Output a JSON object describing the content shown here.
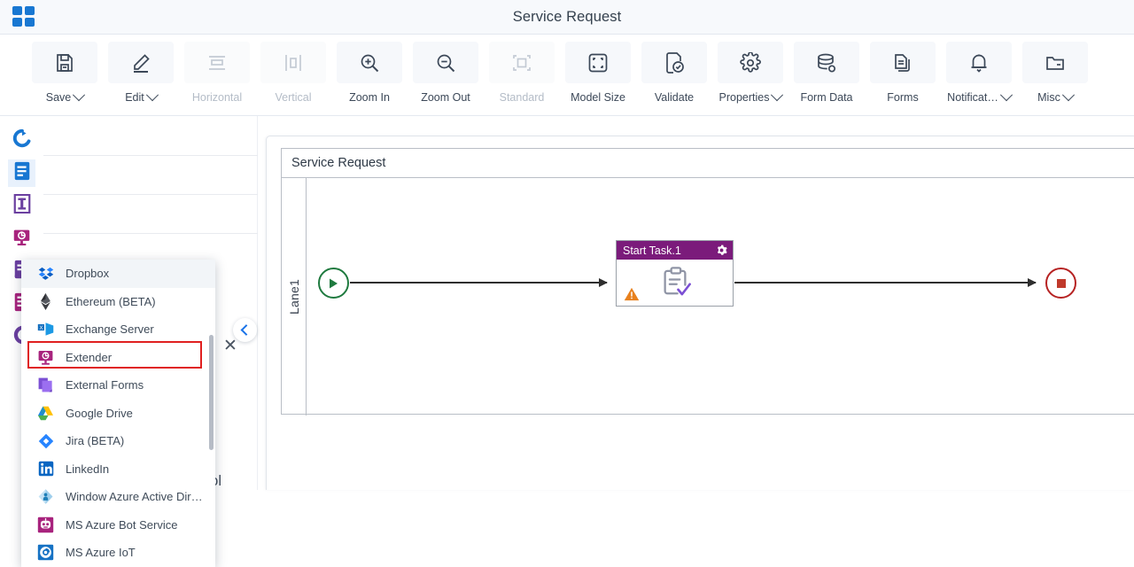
{
  "app": {
    "logo_icon": "grid-apps-icon",
    "title": "Service Request"
  },
  "toolbar": {
    "items": [
      {
        "label": "Save",
        "icon": "save-floppy-icon",
        "has_caret": true,
        "disabled": false
      },
      {
        "label": "Edit",
        "icon": "pencil-edit-icon",
        "has_caret": true,
        "disabled": false
      },
      {
        "label": "Horizontal",
        "icon": "horizontal-align-icon",
        "has_caret": false,
        "disabled": true
      },
      {
        "label": "Vertical",
        "icon": "vertical-align-icon",
        "has_caret": false,
        "disabled": true
      },
      {
        "label": "Zoom In",
        "icon": "zoom-in-icon",
        "has_caret": false,
        "disabled": false
      },
      {
        "label": "Zoom Out",
        "icon": "zoom-out-icon",
        "has_caret": false,
        "disabled": false
      },
      {
        "label": "Standard",
        "icon": "standard-fit-icon",
        "has_caret": false,
        "disabled": true
      },
      {
        "label": "Model Size",
        "icon": "model-size-icon",
        "has_caret": false,
        "disabled": false
      },
      {
        "label": "Validate",
        "icon": "validate-check-icon",
        "has_caret": false,
        "disabled": false
      },
      {
        "label": "Properties",
        "icon": "gear-properties-icon",
        "has_caret": true,
        "disabled": false
      },
      {
        "label": "Form Data",
        "icon": "database-form-data-icon",
        "has_caret": false,
        "disabled": false
      },
      {
        "label": "Forms",
        "icon": "forms-document-icon",
        "has_caret": false,
        "disabled": false
      },
      {
        "label": "Notificat…",
        "icon": "bell-notification-icon",
        "has_caret": true,
        "disabled": false
      },
      {
        "label": "Misc",
        "icon": "folder-misc-icon",
        "has_caret": true,
        "disabled": false
      }
    ]
  },
  "sidebar_rail": {
    "items": [
      {
        "icon": "connector-round-icon",
        "color": "#1877d2",
        "active": false
      },
      {
        "icon": "blue-doc-icon",
        "color": "#1877d2",
        "active": true
      },
      {
        "icon": "purple-bracket-icon",
        "color": "#6b3fa0",
        "active": false
      },
      {
        "icon": "magenta-monitor-icon",
        "color": "#a8237d",
        "active": false
      },
      {
        "icon": "violet-form-icon",
        "color": "#6b3fa0",
        "active": false
      },
      {
        "icon": "magenta-list-icon",
        "color": "#a8237d",
        "active": false
      },
      {
        "icon": "purple-c-icon",
        "color": "#6b3fa0",
        "active": false
      }
    ]
  },
  "left_panel": {
    "close_icon": "close-x-icon",
    "collapse_icon": "chevron-left-icon",
    "bottom_entry": {
      "label": "Dynamic Task Pool",
      "icon": "dynamic-task-pool-icon"
    }
  },
  "dropdown": {
    "scrollbar": "vertical-scrollbar",
    "selected_highlight": "Extender",
    "highlight_color": "#e02020",
    "items": [
      {
        "label": "Dropbox",
        "icon": "dropbox-icon",
        "highlighted": true,
        "outlined": false
      },
      {
        "label": "Ethereum (BETA)",
        "icon": "ethereum-icon",
        "highlighted": false,
        "outlined": false
      },
      {
        "label": "Exchange Server",
        "icon": "exchange-server-icon",
        "highlighted": false,
        "outlined": false
      },
      {
        "label": "Extender",
        "icon": "extender-icon",
        "highlighted": false,
        "outlined": true
      },
      {
        "label": "External Forms",
        "icon": "external-forms-icon",
        "highlighted": false,
        "outlined": false
      },
      {
        "label": "Google Drive",
        "icon": "google-drive-icon",
        "highlighted": false,
        "outlined": false
      },
      {
        "label": "Jira (BETA)",
        "icon": "jira-icon",
        "highlighted": false,
        "outlined": false
      },
      {
        "label": "LinkedIn",
        "icon": "linkedin-icon",
        "highlighted": false,
        "outlined": false
      },
      {
        "label": "Window Azure Active Dir…",
        "icon": "azure-ad-icon",
        "highlighted": false,
        "outlined": false
      },
      {
        "label": "MS Azure Bot Service",
        "icon": "azure-bot-icon",
        "highlighted": false,
        "outlined": false
      },
      {
        "label": "MS Azure IoT",
        "icon": "azure-iot-icon",
        "highlighted": false,
        "outlined": false
      }
    ]
  },
  "canvas": {
    "pool_title": "Service Request",
    "lane_label": "Lane1",
    "nodes": [
      {
        "type": "start-event",
        "name": "start-event",
        "icon": "play-triangle-icon",
        "color": "#1f7a3f"
      },
      {
        "type": "task",
        "name": "Start Task.1",
        "icon": "clipboard-check-icon",
        "header_color": "#7b1b7b",
        "gear_icon": "gear-icon",
        "warning_icon": "warning-triangle-icon"
      },
      {
        "type": "end-event",
        "name": "end-event",
        "icon": "stop-square-icon",
        "color": "#c0392b"
      }
    ],
    "connections": [
      {
        "from": "start-event",
        "to": "Start Task.1"
      },
      {
        "from": "Start Task.1",
        "to": "end-event"
      }
    ]
  }
}
